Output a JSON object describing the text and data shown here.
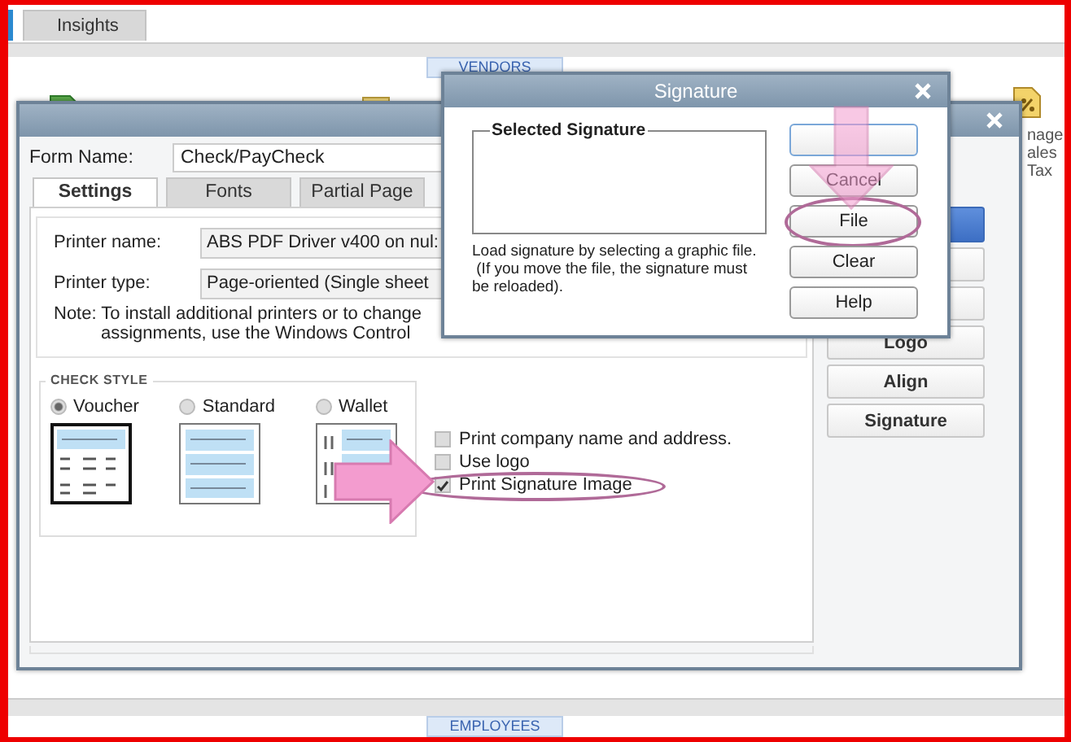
{
  "app": {
    "tabs": [
      {
        "selected": true
      },
      {
        "label": "Insights",
        "selected": false
      }
    ],
    "top_section": "VENDORS",
    "bottom_section": "EMPLOYEES",
    "side_label": "nage\nales\nTax"
  },
  "form_window": {
    "form_name_label": "Form Name:",
    "form_name": "Check/PayCheck",
    "tabs": [
      {
        "label": "Settings",
        "selected": true
      },
      {
        "label": "Fonts",
        "selected": false
      },
      {
        "label": "Partial Page",
        "selected": false
      }
    ],
    "printer_name_label": "Printer name:",
    "printer_name": "ABS PDF Driver v400 on nul:",
    "printer_type_label": "Printer type:",
    "printer_type": "Page-oriented (Single sheet",
    "note": "Note: To install additional printers or to change\nassignments, use the Windows Control",
    "check_style": {
      "title": "CHECK STYLE",
      "options": [
        {
          "label": "Voucher",
          "selected": true,
          "kind": "voucher"
        },
        {
          "label": "Standard",
          "selected": false,
          "kind": "standard"
        },
        {
          "label": "Wallet",
          "selected": false,
          "kind": "wallet"
        }
      ]
    },
    "options": [
      {
        "label": "Print company name and address.",
        "checked": false,
        "highlighted": false
      },
      {
        "label": "Use logo",
        "checked": false,
        "highlighted": false
      },
      {
        "label": "Print Signature Image",
        "checked": true,
        "highlighted": true
      }
    ],
    "buttons": [
      {
        "kind": "primary"
      },
      {
        "kind": "plain"
      },
      {
        "kind": "plain"
      },
      {
        "label": "Logo",
        "kind": "plain"
      },
      {
        "label": "Align",
        "kind": "plain"
      },
      {
        "label": "Signature",
        "kind": "plain"
      }
    ]
  },
  "signature_dialog": {
    "title": "Signature",
    "group_label": "Selected Signature",
    "hint": "Load signature by selecting a graphic file.\n (If you move the file, the signature must\nbe reloaded).",
    "buttons": [
      {
        "highlighted": false
      },
      {
        "label": "Cancel",
        "highlighted": false
      },
      {
        "label": "File",
        "highlighted": true
      },
      {
        "label": "Clear",
        "highlighted": false
      },
      {
        "label": "Help",
        "highlighted": false
      }
    ]
  }
}
